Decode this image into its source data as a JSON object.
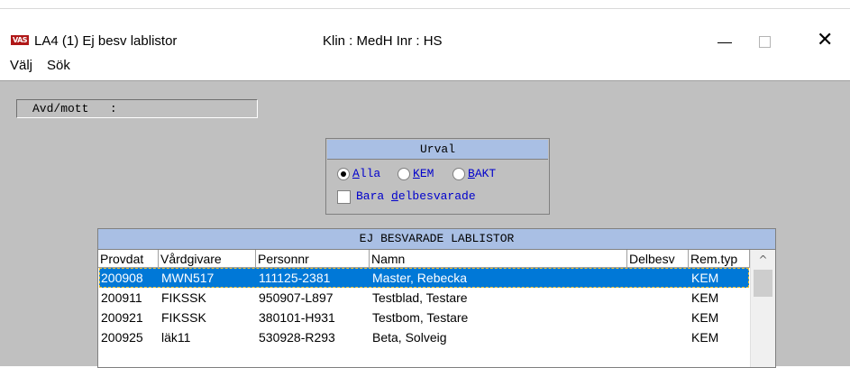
{
  "window": {
    "app_icon_text": "VAS",
    "title": "LA4 (1) Ej besv lablistor",
    "context": "Klin : MedH  Inr : HS",
    "minimize_symbol": "—",
    "close_symbol": "✕"
  },
  "menu": {
    "items": [
      {
        "label": "Välj"
      },
      {
        "label": "Sök"
      }
    ]
  },
  "avd_field": {
    "label": "Avd/mott   :"
  },
  "urval": {
    "title": "Urval",
    "selected": "Alla",
    "options": [
      {
        "label": "Alla",
        "underline": "A",
        "rest": "lla"
      },
      {
        "label": "KEM",
        "underline": "K",
        "rest": "EM"
      },
      {
        "label": "BAKT",
        "underline": "B",
        "rest": "AKT"
      }
    ],
    "checkbox": {
      "pre": "Bara ",
      "underline": "d",
      "rest": "elbesvarade",
      "checked": false
    }
  },
  "list": {
    "title": "EJ BESVARADE LABLISTOR",
    "columns": [
      "Provdat",
      "Vårdgivare",
      "Personnr",
      "Namn",
      "Delbesv",
      "Rem.typ"
    ],
    "rows": [
      {
        "provdat": "200908",
        "vardgivare": "MWN517",
        "personnr": "111125-2381",
        "namn": "Master, Rebecka",
        "delbesv": "",
        "remtyp": "KEM",
        "selected": true
      },
      {
        "provdat": "200911",
        "vardgivare": "FIKSSK",
        "personnr": "950907-L897",
        "namn": "Testblad, Testare",
        "delbesv": "",
        "remtyp": "KEM",
        "selected": false
      },
      {
        "provdat": "200921",
        "vardgivare": "FIKSSK",
        "personnr": "380101-H931",
        "namn": "Testbom, Testare",
        "delbesv": "",
        "remtyp": "KEM",
        "selected": false
      },
      {
        "provdat": "200925",
        "vardgivare": "läk11",
        "personnr": "530928-R293",
        "namn": "Beta, Solveig",
        "delbesv": "",
        "remtyp": "KEM",
        "selected": false
      }
    ],
    "scroll_up_symbol": "^"
  },
  "colors": {
    "header_blue": "#a9bfe4",
    "selection_blue": "#0078d7",
    "dialog_gray": "#c0c0c0",
    "link_blue": "#0000cc"
  }
}
